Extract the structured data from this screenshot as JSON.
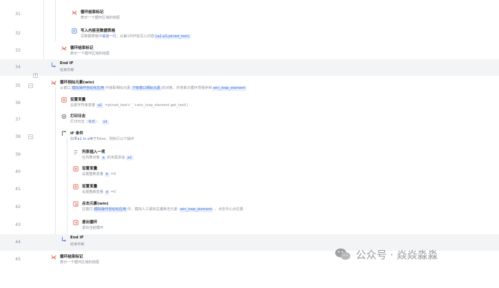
{
  "rows": [
    {
      "line": "31",
      "title": "循环结束标记",
      "desc": "表示一个循环区域的结尾"
    },
    {
      "line": "32",
      "title": "写入内容至数据表格",
      "desc_pre": "写数据表格中",
      "desc_link": "追加一行",
      "desc_mid": "，从第1列开始写入内容",
      "desc_tok": "[a2,a3,joined_text]"
    },
    {
      "line": "33",
      "title": "循环结束标记",
      "desc": "表示一个循环区域的结尾"
    },
    {
      "line": "34",
      "title": "End IF",
      "desc": "结束判断"
    },
    {
      "line": "35",
      "title": "循环相似元素(win)",
      "desc_pre": "从窗口",
      "desc_tok1": "模拟操作自动化应用",
      "desc_mid": "中获取相似元素",
      "desc_tok2": "下级窗口相似元素",
      "desc_mid2": "的对象，并将单次循环项保存到",
      "desc_tok3": "win_loop_element"
    },
    {
      "line": "36",
      "title": "设置变量",
      "desc_pre": "设置字符串变量",
      "desc_tok1": "a1",
      "desc_mid": "=",
      "desc_tok2": "joined_text+'_'+win_loop_element.get_text()"
    },
    {
      "line": "37",
      "title": "打印日志",
      "desc_pre": "打印日志（",
      "desc_tok1": "信息",
      "desc_mid": "）：",
      "desc_tok2": "a1"
    },
    {
      "line": "38",
      "title": "IF 条件",
      "desc_pre": "如果",
      "desc_tok1": "a1 in a",
      "desc_mid": "等于False，则执行以下操作"
    },
    {
      "line": "39",
      "title": "列表插入一项",
      "desc_pre": "在列表对象",
      "desc_tok1": "a",
      "desc_mid": "的末尾添加",
      "desc_tok2": "a1"
    },
    {
      "line": "40",
      "title": "设置变量",
      "desc_pre": "设置整数变量",
      "desc_tok1": "b",
      "desc_mid": "=0"
    },
    {
      "line": "41",
      "title": "设置变量",
      "desc_pre": "设置整数变量",
      "desc_tok1": "d",
      "desc_mid": "=0"
    },
    {
      "line": "42",
      "title": "点击元素(win)",
      "desc_pre": "在窗口",
      "desc_tok1": "模拟操作自动化应用",
      "desc_mid": "中，模拟人工鼠标左键单击元素",
      "desc_tok2": "win_loop_element",
      "desc_mid2": "，点击中心点位置"
    },
    {
      "line": "43",
      "title": "退出循环",
      "desc": "退出当前循环"
    },
    {
      "line": "44",
      "title": "End IF",
      "desc": "结束判断"
    },
    {
      "line": "45",
      "title": "循环结束标记",
      "desc": "表示一个循环区域的结尾"
    }
  ],
  "fold_minus": "−",
  "fold_plus": "+",
  "watermark": {
    "text": "公众号 · 焱焱淼淼",
    "icon": "wechat-icon"
  },
  "colors": {
    "accent": "#3b6fd8",
    "token_bg": "#e8f0fe",
    "highlight": "#f3f4f6",
    "icon_red": "#e05a4b",
    "icon_blue": "#4a7bd8",
    "muted": "#8a8f99"
  }
}
